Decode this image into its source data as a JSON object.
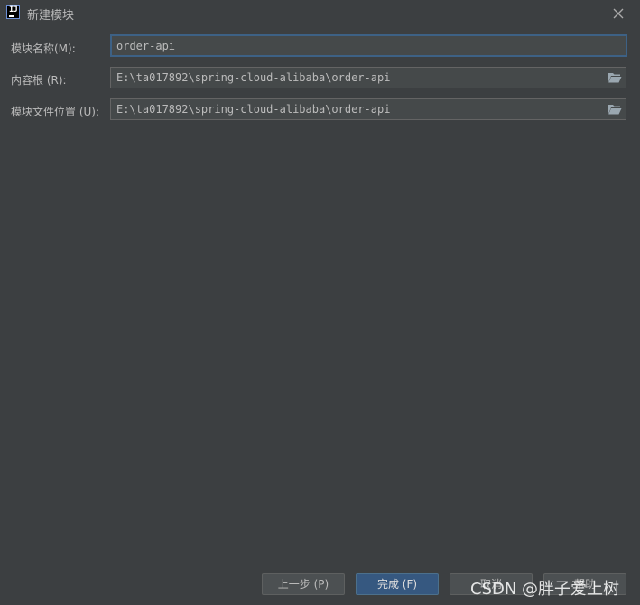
{
  "window": {
    "title": "新建模块",
    "app_icon_text": "IJ"
  },
  "form": {
    "module_name": {
      "label": "模块名称(M):",
      "value": "order-api"
    },
    "content_root": {
      "label": "内容根 (R):",
      "value": "E:\\ta017892\\spring-cloud-alibaba\\order-api"
    },
    "module_file_location": {
      "label": "模块文件位置 (U):",
      "value": "E:\\ta017892\\spring-cloud-alibaba\\order-api"
    }
  },
  "footer": {
    "prev_label": "上一步 (P)",
    "finish_label": "完成 (F)",
    "cancel_label": "取消",
    "help_label": "帮助"
  },
  "watermark": "CSDN @胖子爱上树",
  "icons": {
    "close": "close-icon",
    "folder": "folder-icon",
    "app": "intellij-icon"
  },
  "colors": {
    "background": "#3c3f41",
    "field_bg": "#45494a",
    "focus_border": "#3d6185",
    "primary_button": "#365880",
    "text": "#bbbbbb"
  }
}
